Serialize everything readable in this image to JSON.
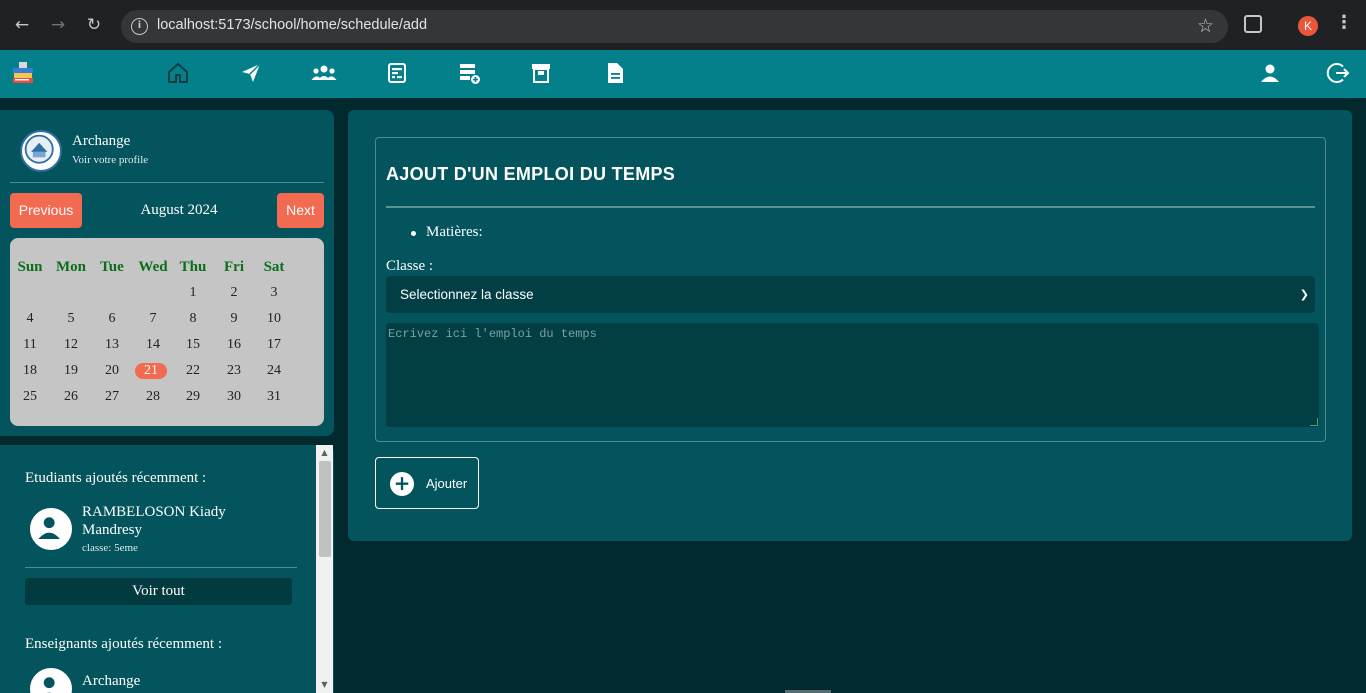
{
  "browser": {
    "url": "localhost:5173/school/home/schedule/add",
    "profile_initial": "K"
  },
  "colors": {
    "navbar": "#03808a",
    "panel": "#03545c",
    "background": "#022a2e",
    "accent_orange": "#f26a4f",
    "weekday_green": "#0c6e1a"
  },
  "navbar": {
    "icons": [
      "logo-books-icon",
      "home-icon",
      "send-icon",
      "group-icon",
      "schedule-icon",
      "schedule-add-icon",
      "board-icon",
      "document-icon",
      "user-icon",
      "logout-icon"
    ]
  },
  "profile": {
    "name": "Archange",
    "link": "Voir votre profile"
  },
  "calendar": {
    "prev_label": "Previous",
    "next_label": "Next",
    "month_label": "August 2024",
    "weekdays": [
      "Sun",
      "Mon",
      "Tue",
      "Wed",
      "Thu",
      "Fri",
      "Sat"
    ],
    "weeks": [
      [
        "",
        "",
        "",
        "",
        "1",
        "2",
        "3"
      ],
      [
        "4",
        "5",
        "6",
        "7",
        "8",
        "9",
        "10"
      ],
      [
        "11",
        "12",
        "13",
        "14",
        "15",
        "16",
        "17"
      ],
      [
        "18",
        "19",
        "20",
        "21",
        "22",
        "23",
        "24"
      ],
      [
        "25",
        "26",
        "27",
        "28",
        "29",
        "30",
        "31"
      ]
    ],
    "today": "21"
  },
  "recent": {
    "students_heading": "Etudiants ajoutés récemment :",
    "student": {
      "name": "RAMBELOSON Kiady Mandresy",
      "class": "classe: 5eme"
    },
    "see_all": "Voir tout",
    "teachers_heading": "Enseignants ajoutés récemment :",
    "teacher": {
      "name": "Archange"
    }
  },
  "form": {
    "title": "AJOUT D'UN EMPLOI DU TEMPS",
    "bullet": "Matières:",
    "classe_label": "Classe :",
    "select_value": "Selectionnez la classe",
    "textarea_placeholder": "Ecrivez ici l'emploi du temps",
    "submit_label": "Ajouter"
  }
}
